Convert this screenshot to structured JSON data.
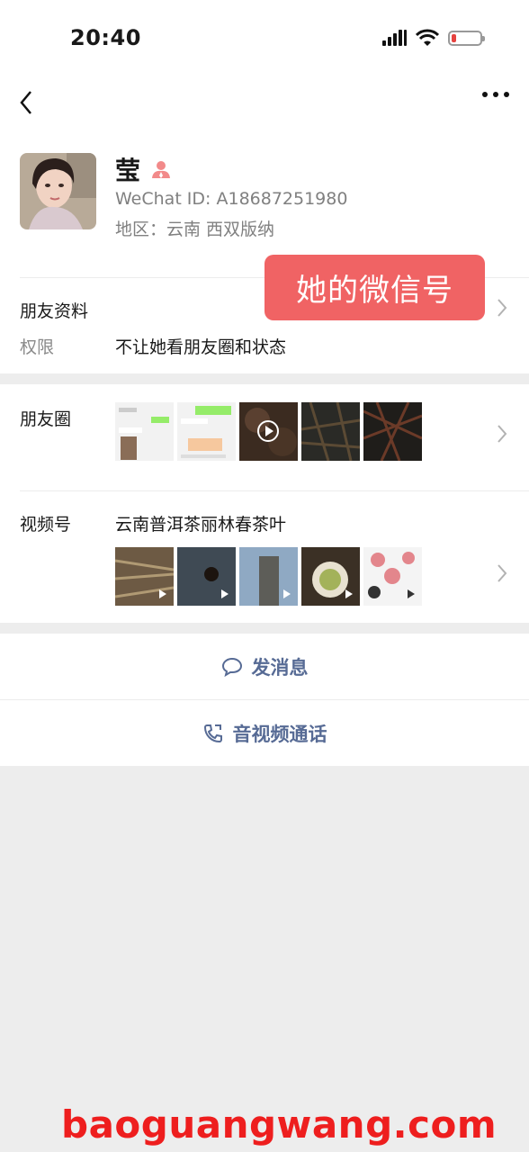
{
  "status_bar": {
    "time": "20:40",
    "battery_level": 0.15,
    "battery_color": "#e64340"
  },
  "icons": {
    "back": "chevron-left-icon",
    "more": "more-dots-icon",
    "gender": "person-icon"
  },
  "profile": {
    "name": "莹",
    "wechat_id": "WeChat ID: A18687251980",
    "region": "地区：云南 西双版纳"
  },
  "overlay_badge": "她的微信号",
  "friend_info": {
    "label": "朋友资料",
    "permission_label": "权限",
    "permission_value": "不让她看朋友圈和状态"
  },
  "moments": {
    "label": "朋友圈",
    "thumbs": [
      "chat-screenshot",
      "chat-screenshot",
      "tea-video",
      "tea-leaves",
      "tea-leaves"
    ]
  },
  "channels": {
    "label": "视频号",
    "title": "云南普洱茶丽林春茶叶",
    "thumbs": [
      "tea-leaves-video",
      "tea-cake-video",
      "tree-video",
      "tea-cup-video",
      "floral-video"
    ]
  },
  "actions": {
    "message": "发消息",
    "call": "音视频通话"
  },
  "watermark": "baoguangwang.com",
  "colors": {
    "link": "#576b95",
    "badge": "#f06364",
    "watermark": "#ee1e1e"
  }
}
